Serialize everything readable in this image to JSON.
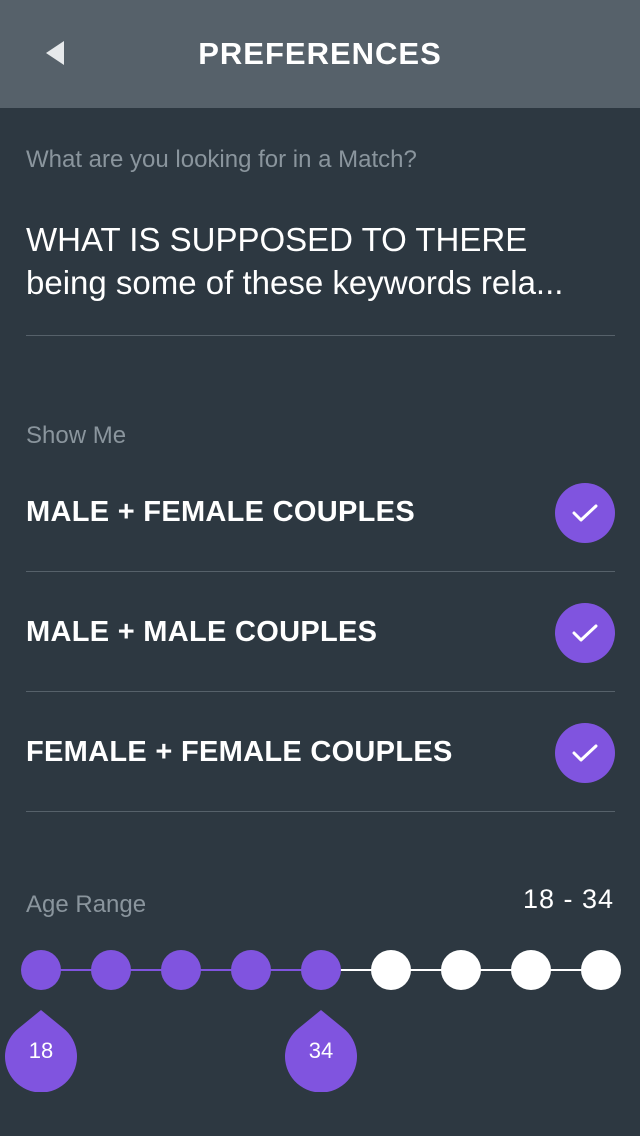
{
  "header": {
    "title": "PREFERENCES",
    "back_icon": "chevron-left-icon"
  },
  "match": {
    "label": "What are you looking for in a Match?",
    "value_line1": "WHAT IS SUPPOSED TO THERE",
    "value_line2": "being some of these keywords rela..."
  },
  "show_me": {
    "label": "Show Me",
    "options": [
      {
        "label": "MALE + FEMALE COUPLES",
        "checked": true
      },
      {
        "label": "MALE + MALE COUPLES",
        "checked": true
      },
      {
        "label": "FEMALE + FEMALE COUPLES",
        "checked": true
      }
    ]
  },
  "age_range": {
    "label": "Age Range",
    "value": "18 - 34",
    "min_label": "18",
    "max_label": "34",
    "stop_count": 9,
    "selected_start_index": 0,
    "selected_end_index": 4
  },
  "colors": {
    "background": "#2d3841",
    "header": "#56616a",
    "accent": "#8054df",
    "divider": "#56616a",
    "muted_text": "#8a959d",
    "dot_inactive": "#ffffff"
  }
}
